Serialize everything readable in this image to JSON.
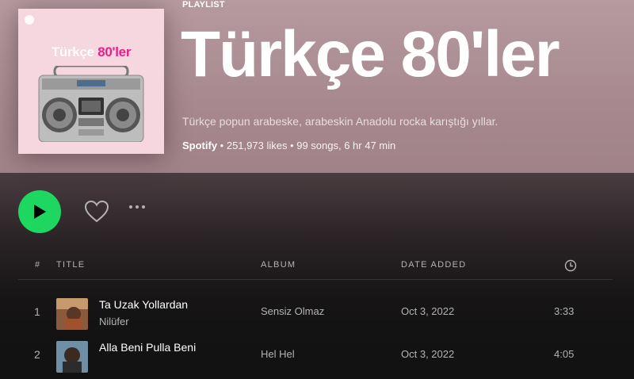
{
  "playlist": {
    "type_label": "PLAYLIST",
    "title": "Türkçe 80'ler",
    "description": "Türkçe popun arabeske, arabeskin Anadolu rocka karıştığı yıllar.",
    "owner": "Spotify",
    "stats": " • 251,973 likes • 99 songs, 6 hr 47 min",
    "cover": {
      "title_white": "Türkçe ",
      "title_pink": "80'ler",
      "background_color": "#f7d7df",
      "accent_color": "#e91e8a"
    }
  },
  "controls": {
    "play_icon": "play-icon",
    "like_icon": "heart-icon",
    "more_icon": "more-horizontal-icon",
    "play_color": "#1ed760"
  },
  "table": {
    "headers": {
      "num": "#",
      "title": "TITLE",
      "album": "ALBUM",
      "date_added": "DATE ADDED",
      "duration_icon": "clock-icon"
    },
    "rows": [
      {
        "num": "1",
        "title": "Ta Uzak Yollardan",
        "artist": "Nilüfer",
        "album": "Sensiz Olmaz",
        "date_added": "Oct 3, 2022",
        "duration": "3:33"
      },
      {
        "num": "2",
        "title": "Alla Beni Pulla Beni",
        "artist": "",
        "album": "Hel Hel",
        "date_added": "Oct 3, 2022",
        "duration": "4:05"
      }
    ]
  }
}
